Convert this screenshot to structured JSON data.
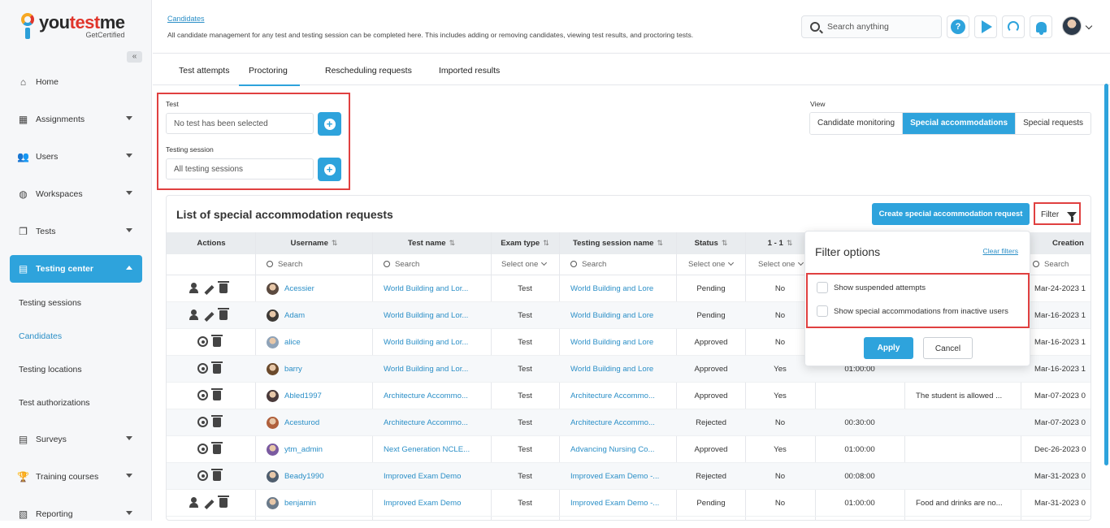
{
  "brand": {
    "name_a": "you",
    "name_b": "test",
    "name_c": "me",
    "tagline": "GetCertified"
  },
  "sidebar": {
    "collapse_glyph": "«",
    "items": [
      {
        "label": "Home",
        "icon": "home-icon"
      },
      {
        "label": "Assignments",
        "icon": "assignments-icon"
      },
      {
        "label": "Users",
        "icon": "users-icon"
      },
      {
        "label": "Workspaces",
        "icon": "globe-icon"
      },
      {
        "label": "Tests",
        "icon": "tests-icon"
      },
      {
        "label": "Testing center",
        "icon": "testing-center-icon"
      },
      {
        "label": "Surveys",
        "icon": "surveys-icon"
      },
      {
        "label": "Training courses",
        "icon": "trophy-icon"
      },
      {
        "label": "Reporting",
        "icon": "reporting-icon"
      }
    ],
    "sub_items": [
      "Testing sessions",
      "Candidates",
      "Testing locations",
      "Test authorizations"
    ]
  },
  "header": {
    "breadcrumb": "Candidates",
    "description": "All candidate management for any test and testing session can be completed here. This includes adding or removing candidates, viewing test results, and proctoring tests.",
    "search_placeholder": "Search anything",
    "help_glyph": "?"
  },
  "tabs": [
    "Test attempts",
    "Proctoring",
    "Rescheduling requests",
    "Imported results"
  ],
  "filters": {
    "test_label": "Test",
    "test_value": "No test has been selected",
    "session_label": "Testing session",
    "session_value": "All testing sessions",
    "plus_glyph": "+"
  },
  "view": {
    "label": "View",
    "options": [
      "Candidate monitoring",
      "Special accommodations",
      "Special requests"
    ],
    "selected": "Special accommodations"
  },
  "panel": {
    "title": "List of special accommodation requests",
    "create_button": "Create special accommodation request",
    "filter_button": "Filter"
  },
  "table": {
    "columns": [
      "Actions",
      "Username",
      "Test name",
      "Exam type",
      "Testing session name",
      "Status",
      "1 - 1",
      "Creation"
    ],
    "sort_glyph": "⇅",
    "search_label": "Search",
    "select_label": "Select one",
    "rows": [
      {
        "actions": "proctor",
        "username": "Acessier",
        "test": "World Building and Lor...",
        "exam": "Test",
        "session": "World Building and Lore",
        "status": "Pending",
        "one": "No",
        "duration": "",
        "note": "",
        "created": "Mar-24-2023 1"
      },
      {
        "actions": "proctor",
        "username": "Adam",
        "test": "World Building and Lor...",
        "exam": "Test",
        "session": "World Building and Lore",
        "status": "Pending",
        "one": "No",
        "duration": "",
        "note": "",
        "created": "Mar-16-2023 1"
      },
      {
        "actions": "view",
        "username": "alice",
        "test": "World Building and Lor...",
        "exam": "Test",
        "session": "World Building and Lore",
        "status": "Approved",
        "one": "No",
        "duration": "",
        "note": "",
        "created": "Mar-16-2023 1"
      },
      {
        "actions": "view",
        "username": "barry",
        "test": "World Building and Lor...",
        "exam": "Test",
        "session": "World Building and Lore",
        "status": "Approved",
        "one": "Yes",
        "duration": "01:00:00",
        "note": "",
        "created": "Mar-16-2023 1"
      },
      {
        "actions": "view",
        "username": "Abled1997",
        "test": "Architecture Accommo...",
        "exam": "Test",
        "session": "Architecture Accommo...",
        "status": "Approved",
        "one": "Yes",
        "duration": "",
        "note": "The student is allowed ...",
        "created": "Mar-07-2023 0"
      },
      {
        "actions": "view",
        "username": "Acesturod",
        "test": "Architecture Accommo...",
        "exam": "Test",
        "session": "Architecture Accommo...",
        "status": "Rejected",
        "one": "No",
        "duration": "00:30:00",
        "note": "",
        "created": "Mar-07-2023 0"
      },
      {
        "actions": "view",
        "username": "ytm_admin",
        "test": "Next Generation NCLE...",
        "exam": "Test",
        "session": "Advancing Nursing Co...",
        "status": "Approved",
        "one": "Yes",
        "duration": "01:00:00",
        "note": "",
        "created": "Dec-26-2023 0"
      },
      {
        "actions": "view",
        "username": "Beady1990",
        "test": "Improved Exam Demo",
        "exam": "Test",
        "session": "Improved Exam Demo -...",
        "status": "Rejected",
        "one": "No",
        "duration": "00:08:00",
        "note": "",
        "created": "Mar-31-2023 0"
      },
      {
        "actions": "proctor",
        "username": "benjamin",
        "test": "Improved Exam Demo",
        "exam": "Test",
        "session": "Improved Exam Demo -...",
        "status": "Pending",
        "one": "No",
        "duration": "01:00:00",
        "note": "Food and drinks are no...",
        "created": "Mar-31-2023 0"
      }
    ]
  },
  "filter_popup": {
    "title": "Filter options",
    "clear": "Clear filters",
    "options": [
      "Show suspended attempts",
      "Show special accommodations from inactive users"
    ],
    "apply": "Apply",
    "cancel": "Cancel"
  },
  "colors": {
    "accent": "#2ea3dc",
    "highlight": "#e04040"
  }
}
